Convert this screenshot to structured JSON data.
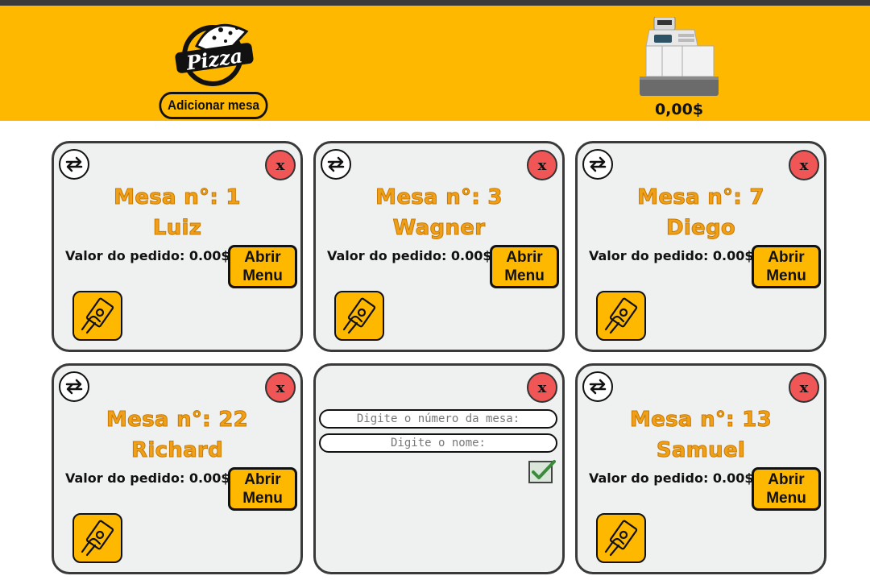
{
  "header": {
    "logo_text": "Pizza",
    "add_table_label": "Adicionar mesa",
    "register_total": "0,00$"
  },
  "colors": {
    "header_bg": "#ffb800",
    "title_text": "#f0a018",
    "close_red": "#f05656",
    "card_bg": "#eff0f0"
  },
  "icons": [
    "swap-icon",
    "close-icon",
    "pay-cash-icon",
    "cash-register-icon",
    "pizza-logo",
    "confirm-check-icon"
  ],
  "tables": [
    {
      "title": "Mesa n°: 1",
      "name": "Luiz",
      "order_value": "Valor do pedido: 0.00$",
      "open_menu": "Abrir Menu",
      "close": "x"
    },
    {
      "title": "Mesa n°: 3",
      "name": "Wagner",
      "order_value": "Valor do pedido: 0.00$",
      "open_menu": "Abrir Menu",
      "close": "x"
    },
    {
      "title": "Mesa n°: 7",
      "name": "Diego",
      "order_value": "Valor do pedido: 0.00$",
      "open_menu": "Abrir Menu",
      "close": "x"
    },
    {
      "title": "Mesa n°: 22",
      "name": "Richard",
      "order_value": "Valor do pedido: 0.00$",
      "open_menu": "Abrir Menu",
      "close": "x"
    },
    {
      "title": "Mesa n°: 13",
      "name": "Samuel",
      "order_value": "Valor do pedido: 0.00$",
      "open_menu": "Abrir Menu",
      "close": "x"
    }
  ],
  "new_table_form": {
    "table_number_placeholder": "Digite o número da mesa:",
    "name_placeholder": "Digite o nome:",
    "close": "x"
  }
}
